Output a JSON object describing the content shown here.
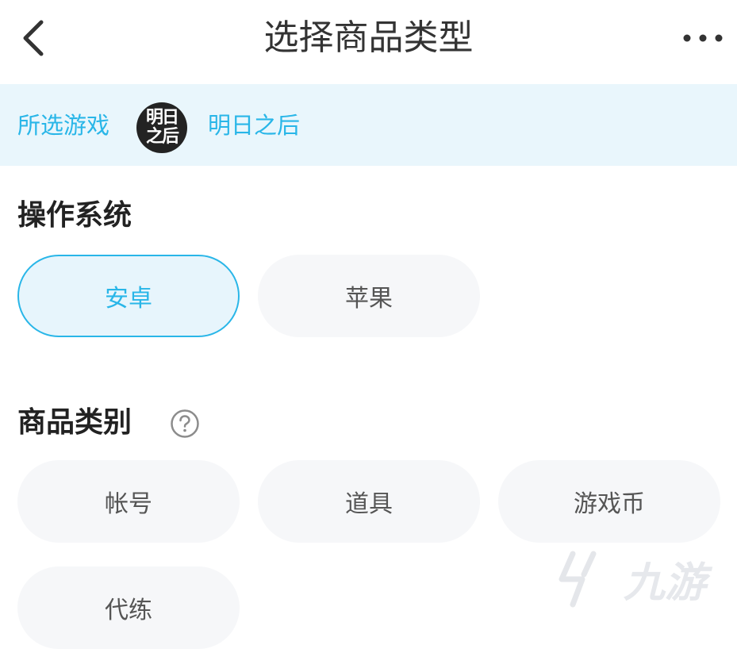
{
  "header": {
    "title": "选择商品类型",
    "back_icon": "chevron-left-icon",
    "more_icon": "more-dots-icon"
  },
  "game_bar": {
    "label": "所选游戏",
    "avatar_line1": "明日",
    "avatar_line2": "之后",
    "game_name": "明日之后"
  },
  "os_section": {
    "title": "操作系统",
    "options": [
      {
        "label": "安卓",
        "selected": true
      },
      {
        "label": "苹果",
        "selected": false
      }
    ]
  },
  "category_section": {
    "title": "商品类别",
    "help_icon": "question-circle-icon",
    "options": [
      {
        "label": "帐号"
      },
      {
        "label": "道具"
      },
      {
        "label": "游戏币"
      },
      {
        "label": "代练"
      }
    ]
  },
  "watermark": {
    "text": "九游"
  },
  "colors": {
    "accent": "#29b6e8",
    "bar_bg": "#e9f6fc",
    "pill_bg": "#f6f7f9",
    "title_text": "#333333"
  }
}
